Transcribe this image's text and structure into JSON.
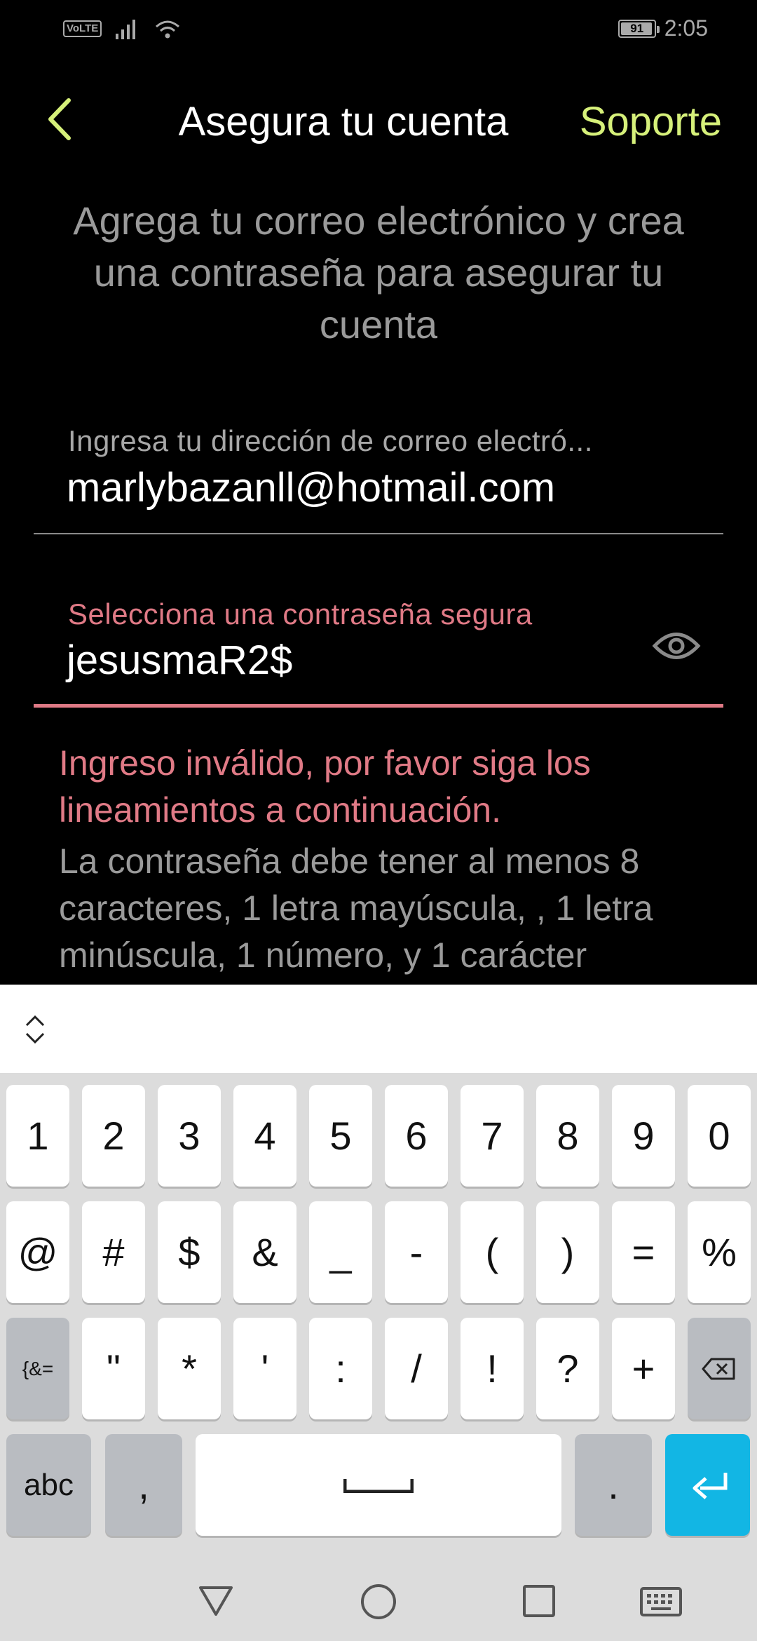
{
  "status_bar": {
    "volte": "VoLTE",
    "battery": "91",
    "time": "2:05"
  },
  "header": {
    "title": "Asegura tu cuenta",
    "support": "Soporte"
  },
  "intro": "Agrega tu correo electrónico y crea una contraseña para asegurar tu cuenta",
  "email": {
    "label": "Ingresa tu dirección de correo electró...",
    "value": "marlybazanll@hotmail.com"
  },
  "password": {
    "label": "Selecciona una contraseña segura",
    "value": "jesusmaR2$"
  },
  "error": "Ingreso inválido, por favor siga los lineamientos a continuación.",
  "help": "La contraseña debe tener al menos 8 caracteres, 1 letra mayúscula, , 1 letra minúscula, 1 número, y 1 carácter",
  "colors": {
    "accent": "#d6f07a",
    "error": "#e07a86",
    "enter_key": "#12b6e4"
  },
  "keyboard": {
    "row1": [
      "1",
      "2",
      "3",
      "4",
      "5",
      "6",
      "7",
      "8",
      "9",
      "0"
    ],
    "row2": [
      "@",
      "#",
      "$",
      "&",
      "_",
      "-",
      "(",
      ")",
      "=",
      "%"
    ],
    "row3": [
      "{&=",
      "\"",
      "*",
      "'",
      ":",
      "/",
      "!",
      "?",
      "+"
    ],
    "abc": "abc",
    "comma": ",",
    "period": "."
  }
}
